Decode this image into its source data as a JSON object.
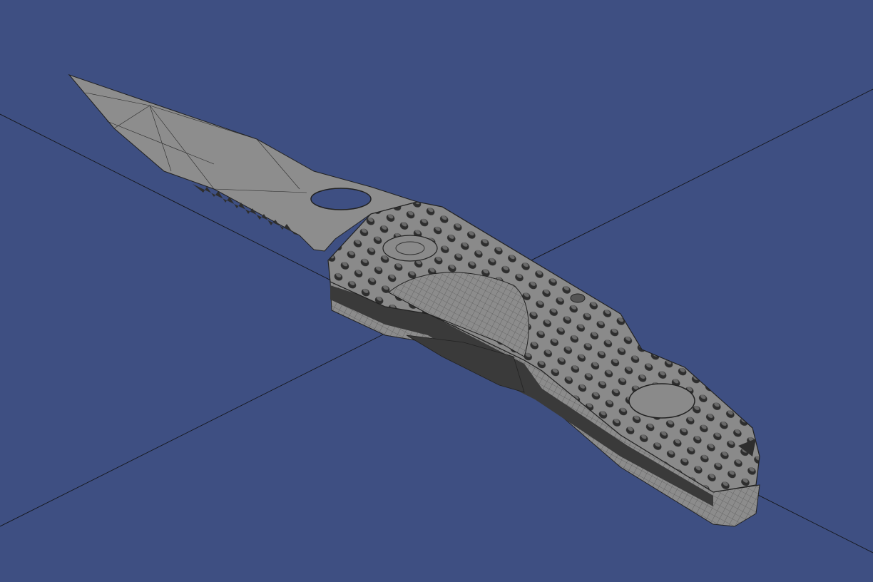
{
  "viewport": {
    "background_color": "#3e4f82",
    "axis_color": "#111111",
    "model_color": "#8a8a8a",
    "model_dark_color": "#3a3a3a",
    "wire_color": "#222222"
  },
  "model": {
    "icon": "folding-knife-mesh"
  }
}
